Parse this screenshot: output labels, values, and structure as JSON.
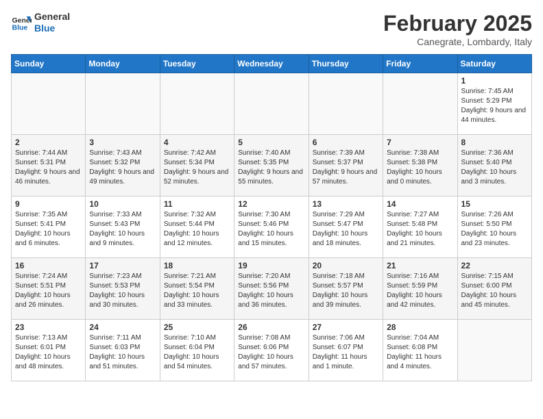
{
  "logo": {
    "line1": "General",
    "line2": "Blue"
  },
  "title": "February 2025",
  "subtitle": "Canegrate, Lombardy, Italy",
  "days_of_week": [
    "Sunday",
    "Monday",
    "Tuesday",
    "Wednesday",
    "Thursday",
    "Friday",
    "Saturday"
  ],
  "weeks": [
    [
      {
        "day": "",
        "info": ""
      },
      {
        "day": "",
        "info": ""
      },
      {
        "day": "",
        "info": ""
      },
      {
        "day": "",
        "info": ""
      },
      {
        "day": "",
        "info": ""
      },
      {
        "day": "",
        "info": ""
      },
      {
        "day": "1",
        "info": "Sunrise: 7:45 AM\nSunset: 5:29 PM\nDaylight: 9 hours and 44 minutes."
      }
    ],
    [
      {
        "day": "2",
        "info": "Sunrise: 7:44 AM\nSunset: 5:31 PM\nDaylight: 9 hours and 46 minutes."
      },
      {
        "day": "3",
        "info": "Sunrise: 7:43 AM\nSunset: 5:32 PM\nDaylight: 9 hours and 49 minutes."
      },
      {
        "day": "4",
        "info": "Sunrise: 7:42 AM\nSunset: 5:34 PM\nDaylight: 9 hours and 52 minutes."
      },
      {
        "day": "5",
        "info": "Sunrise: 7:40 AM\nSunset: 5:35 PM\nDaylight: 9 hours and 55 minutes."
      },
      {
        "day": "6",
        "info": "Sunrise: 7:39 AM\nSunset: 5:37 PM\nDaylight: 9 hours and 57 minutes."
      },
      {
        "day": "7",
        "info": "Sunrise: 7:38 AM\nSunset: 5:38 PM\nDaylight: 10 hours and 0 minutes."
      },
      {
        "day": "8",
        "info": "Sunrise: 7:36 AM\nSunset: 5:40 PM\nDaylight: 10 hours and 3 minutes."
      }
    ],
    [
      {
        "day": "9",
        "info": "Sunrise: 7:35 AM\nSunset: 5:41 PM\nDaylight: 10 hours and 6 minutes."
      },
      {
        "day": "10",
        "info": "Sunrise: 7:33 AM\nSunset: 5:43 PM\nDaylight: 10 hours and 9 minutes."
      },
      {
        "day": "11",
        "info": "Sunrise: 7:32 AM\nSunset: 5:44 PM\nDaylight: 10 hours and 12 minutes."
      },
      {
        "day": "12",
        "info": "Sunrise: 7:30 AM\nSunset: 5:46 PM\nDaylight: 10 hours and 15 minutes."
      },
      {
        "day": "13",
        "info": "Sunrise: 7:29 AM\nSunset: 5:47 PM\nDaylight: 10 hours and 18 minutes."
      },
      {
        "day": "14",
        "info": "Sunrise: 7:27 AM\nSunset: 5:48 PM\nDaylight: 10 hours and 21 minutes."
      },
      {
        "day": "15",
        "info": "Sunrise: 7:26 AM\nSunset: 5:50 PM\nDaylight: 10 hours and 23 minutes."
      }
    ],
    [
      {
        "day": "16",
        "info": "Sunrise: 7:24 AM\nSunset: 5:51 PM\nDaylight: 10 hours and 26 minutes."
      },
      {
        "day": "17",
        "info": "Sunrise: 7:23 AM\nSunset: 5:53 PM\nDaylight: 10 hours and 30 minutes."
      },
      {
        "day": "18",
        "info": "Sunrise: 7:21 AM\nSunset: 5:54 PM\nDaylight: 10 hours and 33 minutes."
      },
      {
        "day": "19",
        "info": "Sunrise: 7:20 AM\nSunset: 5:56 PM\nDaylight: 10 hours and 36 minutes."
      },
      {
        "day": "20",
        "info": "Sunrise: 7:18 AM\nSunset: 5:57 PM\nDaylight: 10 hours and 39 minutes."
      },
      {
        "day": "21",
        "info": "Sunrise: 7:16 AM\nSunset: 5:59 PM\nDaylight: 10 hours and 42 minutes."
      },
      {
        "day": "22",
        "info": "Sunrise: 7:15 AM\nSunset: 6:00 PM\nDaylight: 10 hours and 45 minutes."
      }
    ],
    [
      {
        "day": "23",
        "info": "Sunrise: 7:13 AM\nSunset: 6:01 PM\nDaylight: 10 hours and 48 minutes."
      },
      {
        "day": "24",
        "info": "Sunrise: 7:11 AM\nSunset: 6:03 PM\nDaylight: 10 hours and 51 minutes."
      },
      {
        "day": "25",
        "info": "Sunrise: 7:10 AM\nSunset: 6:04 PM\nDaylight: 10 hours and 54 minutes."
      },
      {
        "day": "26",
        "info": "Sunrise: 7:08 AM\nSunset: 6:06 PM\nDaylight: 10 hours and 57 minutes."
      },
      {
        "day": "27",
        "info": "Sunrise: 7:06 AM\nSunset: 6:07 PM\nDaylight: 11 hours and 1 minute."
      },
      {
        "day": "28",
        "info": "Sunrise: 7:04 AM\nSunset: 6:08 PM\nDaylight: 11 hours and 4 minutes."
      },
      {
        "day": "",
        "info": ""
      }
    ]
  ]
}
